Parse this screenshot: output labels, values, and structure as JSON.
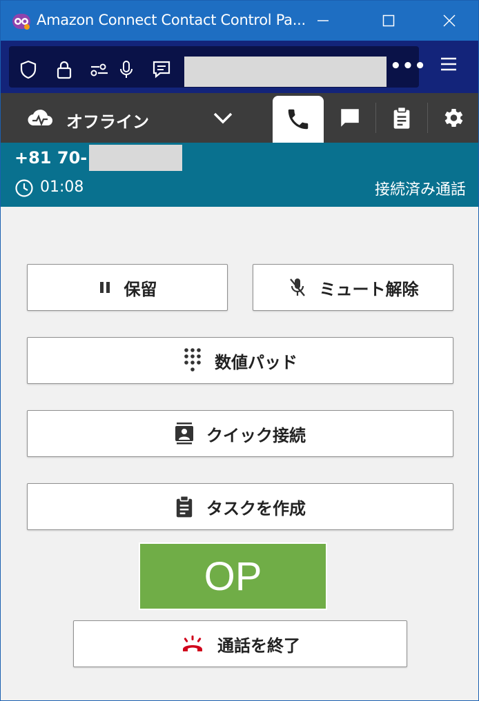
{
  "window": {
    "title": "Amazon Connect Contact Control Pa...",
    "colors": {
      "titlebar": "#1e6ec2",
      "toolbar": "#13247a",
      "header": "#3c3c3c",
      "contact_bar": "#09718f",
      "op": "#70ad47",
      "end_call": "#d0021b"
    }
  },
  "toolbar": {
    "icons": [
      "shield-icon",
      "lock-icon",
      "permissions-icon",
      "microphone-icon",
      "reader-icon"
    ],
    "more_label": "•••",
    "menu_icon": "hamburger-menu-icon"
  },
  "ccp": {
    "status": "オフライン",
    "tabs": [
      "phone-icon",
      "chat-icon",
      "clipboard-icon",
      "gear-icon"
    ],
    "active_tab": "phone"
  },
  "contact": {
    "phone_prefix": "+81 70-",
    "timer": "01:08",
    "state": "接続済み通話"
  },
  "actions": {
    "hold": "保留",
    "unmute": "ミュート解除",
    "numpad": "数値パッド",
    "quick_connect": "クイック接続",
    "create_task": "タスクを作成",
    "op_label": "OP",
    "end_call": "通話を終了"
  }
}
